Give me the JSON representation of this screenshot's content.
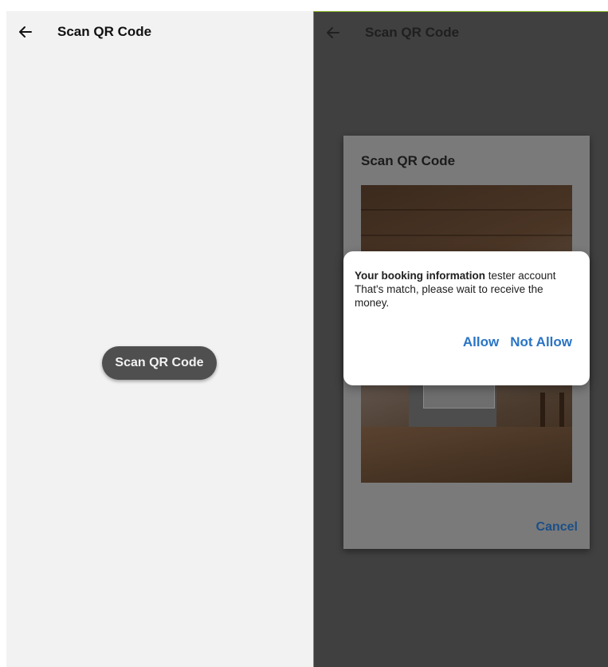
{
  "left_screen": {
    "appbar": {
      "back_icon": "arrow-left-icon",
      "title": "Scan QR Code"
    },
    "scan_button_label": "Scan QR Code"
  },
  "right_screen": {
    "appbar": {
      "back_icon": "arrow-left-icon",
      "title": "Scan QR Code"
    },
    "dialog": {
      "title": "Scan QR Code",
      "cancel_label": "Cancel"
    },
    "alert": {
      "message_bold": "Your booking information",
      "message_rest": " tester account That's match, please wait to receive the money.",
      "allow_label": "Allow",
      "not_allow_label": "Not Allow"
    }
  },
  "colors": {
    "accent": "#2a74c4",
    "overlay": "#404040",
    "button": "#4f4f4f"
  }
}
